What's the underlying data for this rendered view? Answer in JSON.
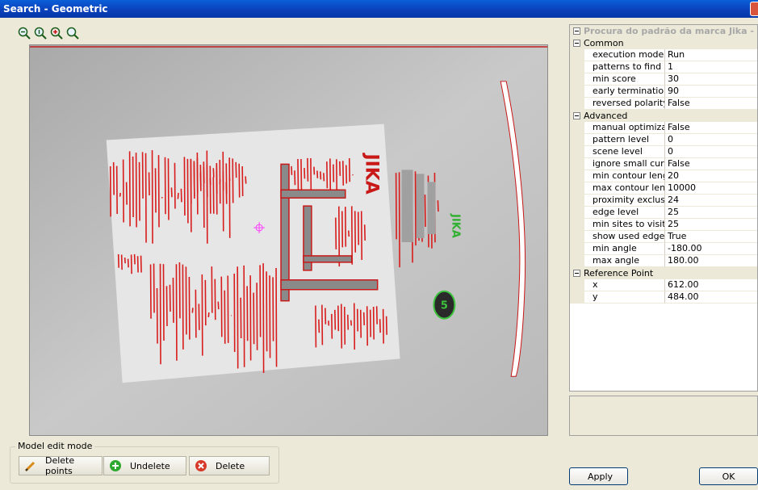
{
  "window": {
    "title": "Search - Geometric"
  },
  "zoom_toolbar": {
    "buttons": [
      {
        "icon": "zoom-out-icon"
      },
      {
        "icon": "zoom-fit-icon"
      },
      {
        "icon": "zoom-in-icon"
      },
      {
        "icon": "zoom-actual-icon"
      }
    ]
  },
  "canvas": {
    "label_text": "JIKA",
    "badge_text": "5",
    "colors": {
      "edges": "#d81c1c",
      "match": "#3cc43c",
      "crosshair": "#ff40ff",
      "background": "#b9b9b9"
    }
  },
  "model_edit": {
    "group_label": "Model edit mode",
    "delete_points_label": "Delete points",
    "undelete_label": "Undelete",
    "delete_label": "Delete"
  },
  "properties": {
    "header": "Procura do padrão da marca Jika - Banhe",
    "common": {
      "label": "Common",
      "rows": [
        {
          "name": "execution mode",
          "value": "Run"
        },
        {
          "name": "patterns to find",
          "value": "1"
        },
        {
          "name": "min score",
          "value": "30"
        },
        {
          "name": "early termination sc",
          "value": "90"
        },
        {
          "name": "reversed polarity",
          "value": "False"
        }
      ]
    },
    "advanced": {
      "label": "Advanced",
      "rows": [
        {
          "name": "manual optimization",
          "value": "False"
        },
        {
          "name": "pattern level",
          "value": "0"
        },
        {
          "name": "scene level",
          "value": "0"
        },
        {
          "name": "ignore small curvatu",
          "value": "False"
        },
        {
          "name": "min contour length",
          "value": "20"
        },
        {
          "name": "max contour length",
          "value": "10000"
        },
        {
          "name": "proximity exclusion",
          "value": "24"
        },
        {
          "name": "edge level",
          "value": "25"
        },
        {
          "name": "min sites to visit",
          "value": "25"
        },
        {
          "name": "show used edges",
          "value": "True"
        },
        {
          "name": "min angle",
          "value": "-180.00"
        },
        {
          "name": "max angle",
          "value": "180.00"
        }
      ]
    },
    "reference_point": {
      "label": "Reference Point",
      "rows": [
        {
          "name": "x",
          "value": "612.00"
        },
        {
          "name": "y",
          "value": "484.00"
        }
      ]
    }
  },
  "buttons": {
    "apply_label": "Apply",
    "ok_label": "OK"
  }
}
